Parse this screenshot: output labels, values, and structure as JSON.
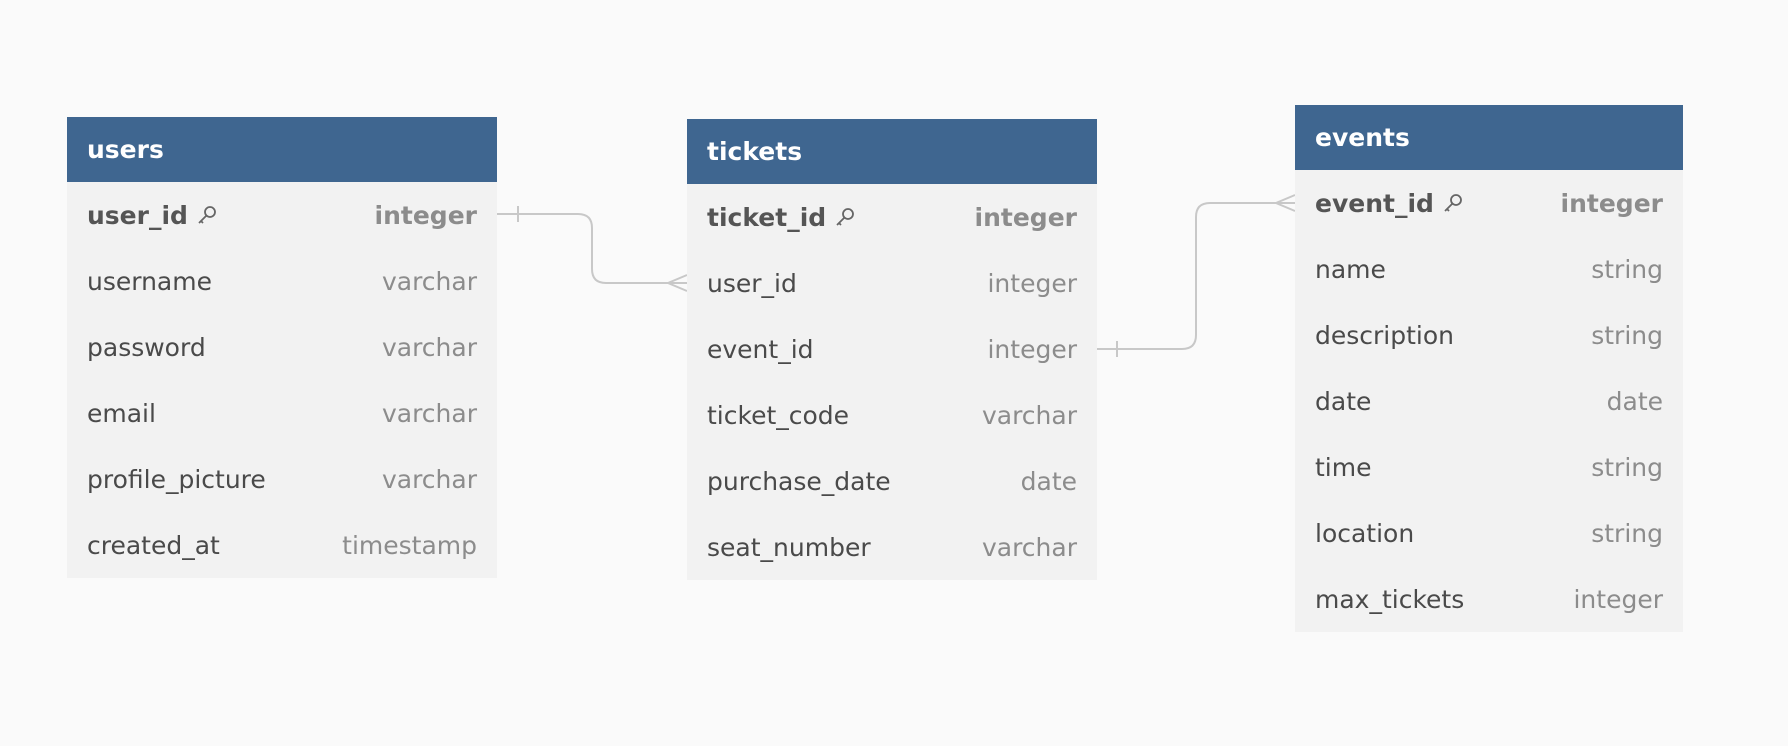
{
  "tables": {
    "users": {
      "name": "users",
      "columns": [
        {
          "name": "user_id",
          "type": "integer",
          "pk": true
        },
        {
          "name": "username",
          "type": "varchar"
        },
        {
          "name": "password",
          "type": "varchar"
        },
        {
          "name": "email",
          "type": "varchar"
        },
        {
          "name": "profile_picture",
          "type": "varchar"
        },
        {
          "name": "created_at",
          "type": "timestamp"
        }
      ]
    },
    "tickets": {
      "name": "tickets",
      "columns": [
        {
          "name": "ticket_id",
          "type": "integer",
          "pk": true
        },
        {
          "name": "user_id",
          "type": "integer"
        },
        {
          "name": "event_id",
          "type": "integer"
        },
        {
          "name": "ticket_code",
          "type": "varchar"
        },
        {
          "name": "purchase_date",
          "type": "date"
        },
        {
          "name": "seat_number",
          "type": "varchar"
        }
      ]
    },
    "events": {
      "name": "events",
      "columns": [
        {
          "name": "event_id",
          "type": "integer",
          "pk": true
        },
        {
          "name": "name",
          "type": "string"
        },
        {
          "name": "description",
          "type": "string"
        },
        {
          "name": "date",
          "type": "date"
        },
        {
          "name": "time",
          "type": "string"
        },
        {
          "name": "location",
          "type": "string"
        },
        {
          "name": "max_tickets",
          "type": "integer"
        }
      ]
    }
  },
  "relationships": [
    {
      "from": "users.user_id",
      "to": "tickets.user_id",
      "from_end": "one",
      "to_end": "many"
    },
    {
      "from": "tickets.event_id",
      "to": "events.event_id",
      "from_end": "one",
      "to_end": "many"
    }
  ],
  "icons": {
    "primary_key": "key-icon"
  },
  "colors": {
    "header_bg": "#3f6690",
    "header_text": "#ffffff",
    "body_bg": "#f2f2f2",
    "canvas_bg": "#fafafa",
    "connector": "#c8c8c8"
  }
}
